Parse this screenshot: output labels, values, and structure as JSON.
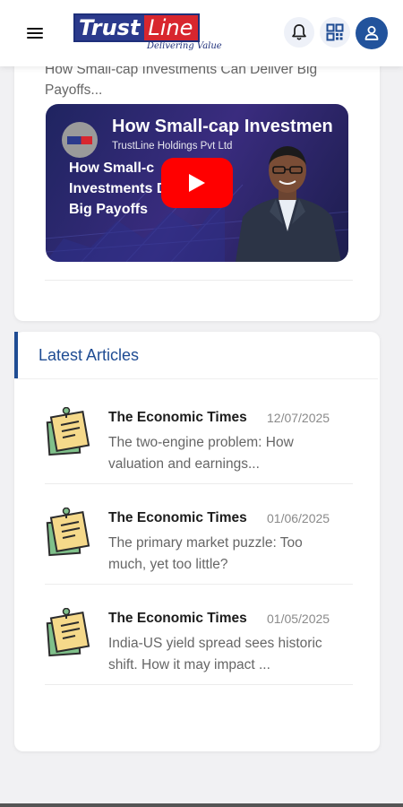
{
  "header": {
    "logo_part1": "Trust",
    "logo_part2": "Line",
    "logo_tagline": "Delivering Value",
    "menu_icon": "hamburger-icon",
    "notification_icon": "bell-icon",
    "qr_icon": "qr-scan-icon",
    "profile_icon": "user-icon"
  },
  "video_card": {
    "title": "How Small-cap Investments Can Deliver Big Payoffs...",
    "thumbnail_title": "How Small-cap Investmen",
    "channel_name": "TrustLine Holdings Pvt Ltd",
    "thumbnail_text": "How Small-c Investments Deliver Big Payoffs",
    "play_icon": "youtube-play-icon"
  },
  "latest_articles": {
    "heading": "Latest Articles",
    "items": [
      {
        "source": "The Economic Times",
        "date": "12/07/2025",
        "summary": "The two-engine problem: How valuation and earnings...",
        "icon": "note-icon"
      },
      {
        "source": "The Economic Times",
        "date": "01/06/2025",
        "summary": "The primary market puzzle: Too much, yet too little?",
        "icon": "note-icon"
      },
      {
        "source": "The Economic Times",
        "date": "01/05/2025",
        "summary": "India-US yield spread sees historic shift. How it may impact ...",
        "icon": "note-icon"
      }
    ]
  },
  "colors": {
    "brand_blue": "#1f4c93",
    "brand_red": "#d8262e",
    "youtube_red": "#ff0000",
    "background": "#f1f1f3"
  }
}
